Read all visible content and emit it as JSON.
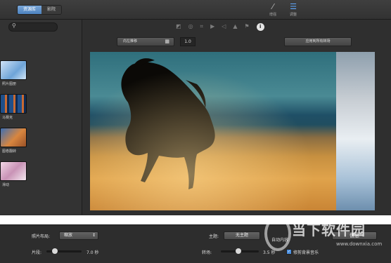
{
  "toolbar": {
    "segments": [
      "资源库",
      "影院"
    ],
    "active_segment": 0,
    "tools": [
      {
        "label": "增强",
        "icon": "magic-wand-icon"
      },
      {
        "label": "调整",
        "icon": "adjust-sliders-icon"
      }
    ]
  },
  "library": {
    "search_placeholder": "",
    "items": [
      {
        "label": "照片图册"
      },
      {
        "label": "马赛克"
      },
      {
        "label": "图卷翻转"
      },
      {
        "label": "滑动"
      }
    ]
  },
  "viewer": {
    "crop_label": "向左推移",
    "value": "1.0",
    "apply_label": "应用到所有转场",
    "colors": {
      "sky": "#2f6f7c",
      "sand": "#e0a34b"
    }
  },
  "bottom": {
    "layout_label": "照片布局:",
    "layout_value": "缩放",
    "theme_label": "主题:",
    "theme_value": "无主题",
    "auto_content": "自动内容",
    "info_button": "信息",
    "clip_label": "片段:",
    "clip_value": "7.0 秒",
    "clip_slider": 0.2,
    "transition_label": "转场:",
    "transition_value": "3.5 秒",
    "transition_slider": 0.45,
    "trim_music_label": "修剪背景音乐",
    "trim_music_checked": true
  },
  "watermark": {
    "name": "当下软件园",
    "url": "www.downxia.com"
  }
}
